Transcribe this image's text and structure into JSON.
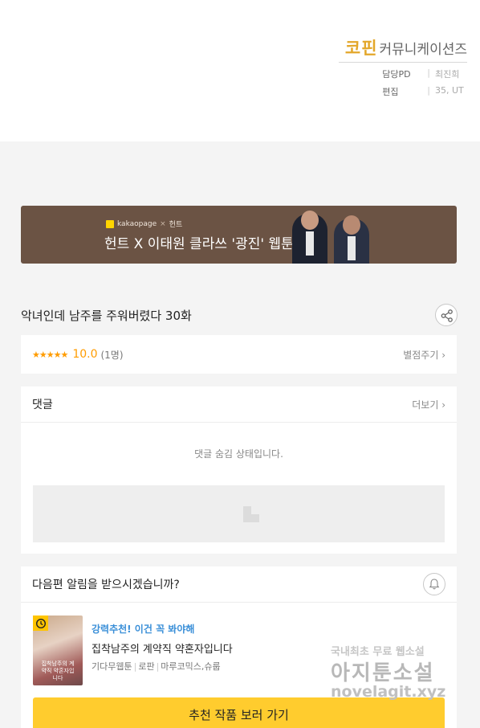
{
  "credits": {
    "brand_mark": "코핀",
    "brand_rest": "커뮤니케이션즈",
    "rows": [
      {
        "key": "담당PD",
        "value": "최진희"
      },
      {
        "key": "편집",
        "value": "35, UT"
      }
    ]
  },
  "banner": {
    "logo_left": "kakaopage",
    "logo_right": "헌트",
    "title": "헌트 X 이태원 클라쓰 '광진' 웹툰"
  },
  "episode": {
    "title": "악녀인데 남주를 주워버렸다 30화"
  },
  "rating": {
    "stars": "★★★★★",
    "score": "10.0",
    "count": "(1명)",
    "link": "별점주기 ›"
  },
  "comments": {
    "title": "댓글",
    "more": "더보기 ›",
    "hidden_message": "댓글 숨김 상태입니다."
  },
  "next_alert": {
    "title": "다음편 알림을 받으시겠습니까?",
    "recommendation": {
      "tag": "강력추천! 이건 꼭 봐야해",
      "title": "집착남주의 계약직 약혼자입니다",
      "genre_1": "기다무웹툰",
      "genre_2": "로판",
      "publisher": "마루코믹스,슈룹",
      "cover_text": "집착남주의 계약직 약혼자입니다"
    },
    "cta": "추천 작품 보러 가기"
  },
  "watermark": {
    "line1": "국내최초 무료 웹소설",
    "line2": "아지툰소설",
    "line3": "novelagit.xyz"
  },
  "colors": {
    "accent": "#ffcc2e",
    "star": "#ff9c00",
    "banner_bg": "#6b5344",
    "rec_tag": "#3a8fd8"
  }
}
